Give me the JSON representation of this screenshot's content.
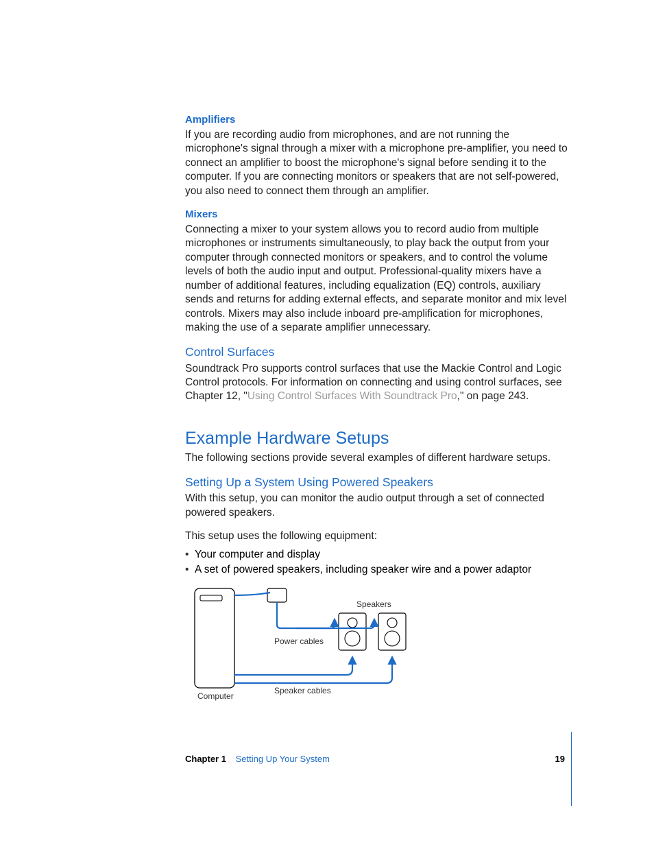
{
  "sections": {
    "amplifiers": {
      "heading": "Amplifiers",
      "body": "If you are recording audio from microphones, and are not running the microphone's signal through a mixer with a microphone pre-amplifier, you need to connect an amplifier to boost the microphone's signal before sending it to the computer. If you are connecting monitors or speakers that are not self-powered, you also need to connect them through an amplifier."
    },
    "mixers": {
      "heading": "Mixers",
      "body": "Connecting a mixer to your system allows you to record audio from multiple microphones or instruments simultaneously, to play back the output from your computer through connected monitors or speakers, and to control the volume levels of both the audio input and output. Professional-quality mixers have a number of additional features, including equalization (EQ) controls, auxiliary sends and returns for adding external effects, and separate monitor and mix level controls. Mixers may also include inboard pre-amplification for microphones, making the use of a separate amplifier unnecessary."
    },
    "control_surfaces": {
      "heading": "Control Surfaces",
      "body_pre": "Soundtrack Pro supports control surfaces that use the Mackie Control and Logic Control protocols. For information on connecting and using control surfaces, see Chapter 12, \"",
      "xref": "Using Control Surfaces With Soundtrack Pro",
      "body_post": ",\" on page 243."
    },
    "example_setups": {
      "heading": "Example Hardware Setups",
      "body": "The following sections provide several examples of different hardware setups."
    },
    "powered_speakers": {
      "heading": "Setting Up a System Using Powered Speakers",
      "body1": "With this setup, you can monitor the audio output through a set of connected powered speakers.",
      "body2": "This setup uses the following equipment:",
      "bullets": [
        "Your computer and display",
        "A set of powered speakers, including speaker wire and a power adaptor"
      ]
    }
  },
  "figure": {
    "labels": {
      "speakers": "Speakers",
      "power_cables": "Power cables",
      "speaker_cables": "Speaker cables",
      "computer": "Computer"
    }
  },
  "footer": {
    "chapter_label": "Chapter 1",
    "chapter_title": "Setting Up Your System",
    "page_number": "19"
  }
}
